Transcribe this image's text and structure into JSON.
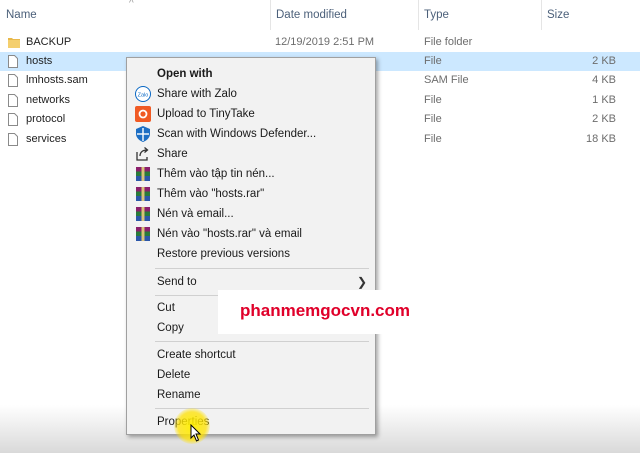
{
  "columns": {
    "name": "Name",
    "date_modified": "Date modified",
    "type": "Type",
    "size": "Size"
  },
  "files": [
    {
      "name": "BACKUP",
      "date": "12/19/2019 2:51 PM",
      "type": "File folder",
      "size": "",
      "icon": "folder-icon"
    },
    {
      "name": "hosts",
      "date": "",
      "type": "File",
      "size": "2 KB",
      "icon": "file-icon",
      "selected": true
    },
    {
      "name": "lmhosts.sam",
      "date": "",
      "type": "SAM File",
      "size": "4 KB",
      "icon": "file-icon"
    },
    {
      "name": "networks",
      "date": "",
      "type": "File",
      "size": "1 KB",
      "icon": "file-icon"
    },
    {
      "name": "protocol",
      "date": "",
      "type": "File",
      "size": "2 KB",
      "icon": "file-icon"
    },
    {
      "name": "services",
      "date": "",
      "type": "File",
      "size": "18 KB",
      "icon": "file-icon"
    }
  ],
  "context_menu": {
    "open_with": "Open with",
    "share_zalo": "Share with Zalo",
    "upload_tinytake": "Upload to TinyTake",
    "scan_defender": "Scan with Windows Defender...",
    "share": "Share",
    "rar_add_archive": "Thêm vào tập tin nén...",
    "rar_add_hosts": "Thêm vào \"hosts.rar\"",
    "rar_compress_email": "Nén và email...",
    "rar_compress_hosts_email": "Nén vào \"hosts.rar\" và email",
    "restore_versions": "Restore previous versions",
    "send_to": "Send to",
    "cut": "Cut",
    "copy": "Copy",
    "create_shortcut": "Create shortcut",
    "delete": "Delete",
    "rename": "Rename",
    "properties": "Properties"
  },
  "watermark": "phanmemgocvn.com",
  "colors": {
    "selection": "#cce8ff",
    "watermark": "#e0002a",
    "folder": "#e8b84a"
  }
}
